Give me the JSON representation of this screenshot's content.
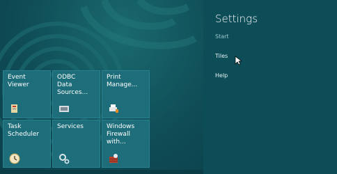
{
  "start": {
    "tiles": [
      {
        "label": "Event\nViewer",
        "icon": "event-viewer-icon"
      },
      {
        "label": "ODBC\nData\nSources...",
        "icon": "odbc-icon"
      },
      {
        "label": "Print\nManage...",
        "icon": "printer-icon"
      },
      {
        "label": "Task\nScheduler",
        "icon": "clock-icon"
      },
      {
        "label": "Services",
        "icon": "gears-icon"
      },
      {
        "label": "Windows\nFirewall\nwith...",
        "icon": "firewall-icon"
      }
    ]
  },
  "settings": {
    "title": "Settings",
    "items": [
      {
        "label": "Start"
      },
      {
        "label": "Tiles"
      },
      {
        "label": "Help"
      }
    ]
  },
  "colors": {
    "tile": "#1d6e7a",
    "panel": "#0c4d58",
    "background": "#0b3f49"
  }
}
